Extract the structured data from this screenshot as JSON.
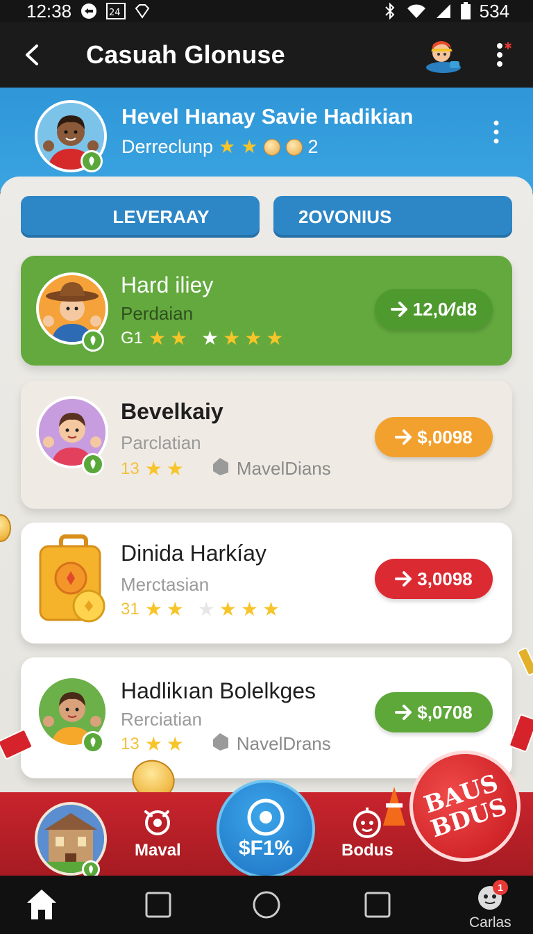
{
  "status": {
    "time": "12:38",
    "battery": "534"
  },
  "appbar": {
    "title": "Casuah Glonuse"
  },
  "profile": {
    "name": "Hevel Hıanay Savie Hadikian",
    "subtitle": "Derreclunp",
    "coin_count": "2"
  },
  "tabs": [
    {
      "label": "LEVERAAY"
    },
    {
      "label": "2OVONIUS"
    }
  ],
  "cards": [
    {
      "title": "Hard iliey",
      "subtitle": "Perdaian",
      "meta_prefix": "G1",
      "meta_extra": "",
      "amount": "12,0⁄/d8",
      "pill_color": "#4e9a2e"
    },
    {
      "title": "Bevelkaiy",
      "subtitle": "Parclatian",
      "meta_prefix": "13",
      "meta_extra": "MavelDians",
      "amount": "$,0098",
      "pill_color": "#f2a12e"
    },
    {
      "title": "Dinida Harkíay",
      "subtitle": "Merctasian",
      "meta_prefix": "31",
      "meta_extra": "",
      "amount": "3,0098",
      "pill_color": "#dc2a33"
    },
    {
      "title": "Hadlikıan Bolelkges",
      "subtitle": "Rerciatian",
      "meta_prefix": "13",
      "meta_extra": "NavelDrans",
      "amount": "$,0708",
      "pill_color": "#5ea83a"
    }
  ],
  "gamebar": {
    "left_label": "Maval",
    "center_label": "$F1%",
    "right_label": "Bodus",
    "bonus_line1": "BAUS",
    "bonus_line2": "BDUS"
  },
  "navbar": {
    "profile_label": "Carlas",
    "notification_count": "1"
  },
  "icons": {
    "back": "arrow-left-icon",
    "more": "vertical-dots-icon",
    "arrow": "arrow-right-icon",
    "home": "home-icon",
    "recents": "square-icon",
    "circle": "circle-home-icon"
  }
}
